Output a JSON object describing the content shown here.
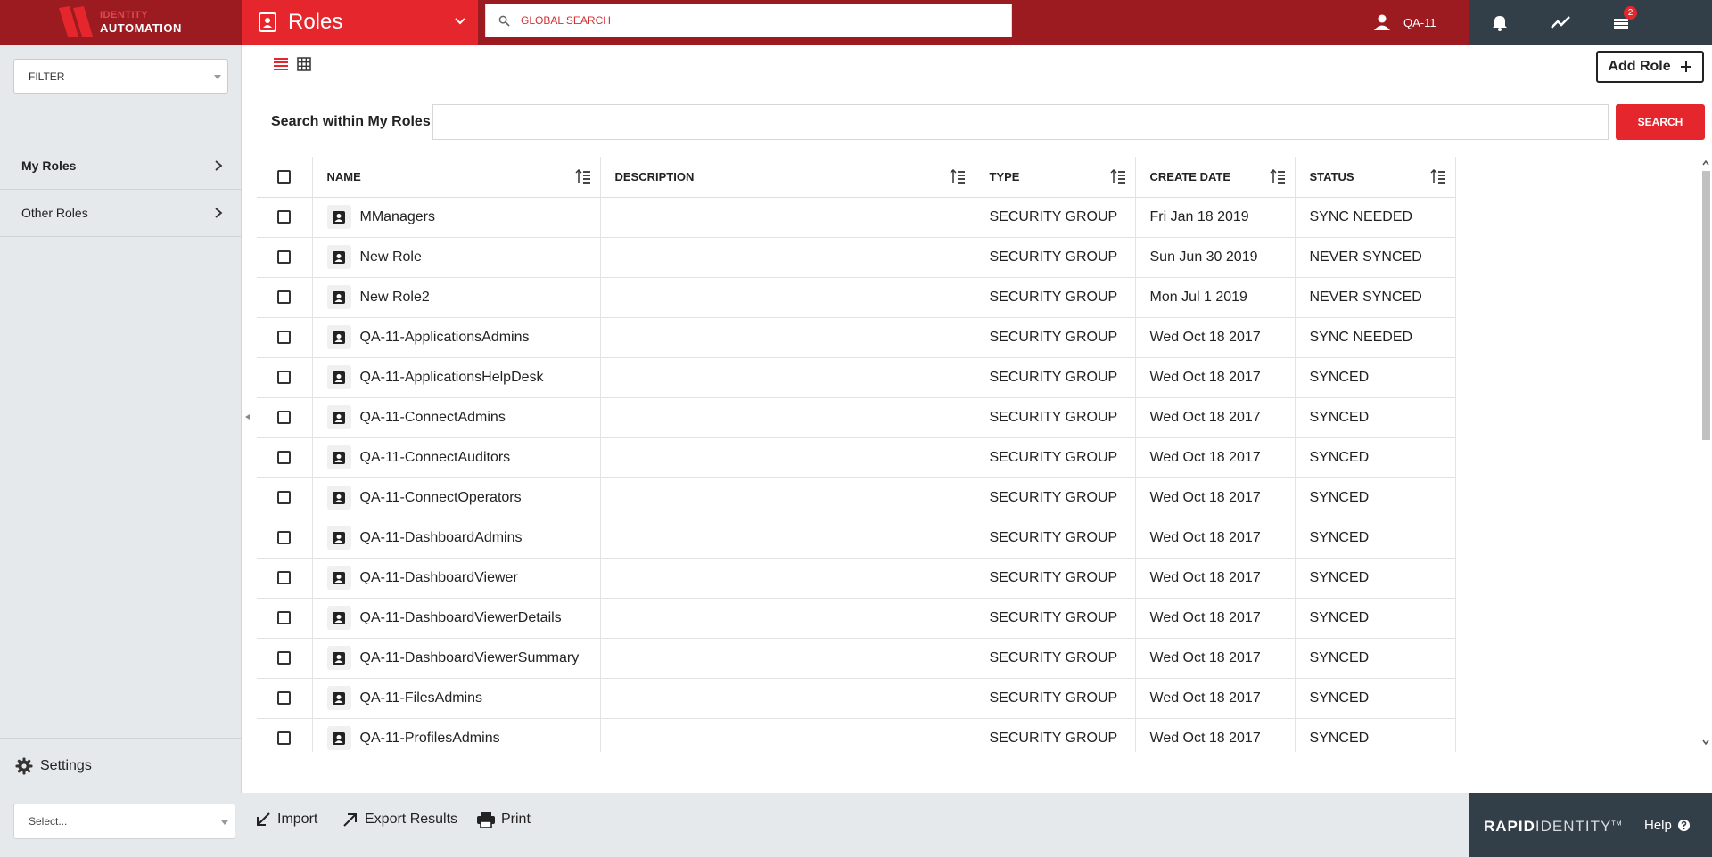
{
  "header": {
    "logo_line1": "IDENTITY",
    "logo_line2": "AUTOMATION",
    "module_title": "Roles",
    "global_search_placeholder": "GLOBAL SEARCH",
    "user_name": "QA-11",
    "notification_badge": "2"
  },
  "sidebar": {
    "filter_label": "FILTER",
    "items": [
      {
        "label": "My Roles",
        "active": true
      },
      {
        "label": "Other Roles",
        "active": false
      }
    ],
    "settings_label": "Settings"
  },
  "main": {
    "add_role_label": "Add Role",
    "search_label": "Search within My Roles:",
    "search_value": "",
    "search_button": "SEARCH"
  },
  "table": {
    "columns": [
      "NAME",
      "DESCRIPTION",
      "TYPE",
      "CREATE DATE",
      "STATUS"
    ],
    "rows": [
      {
        "name": "MManagers",
        "description": "",
        "type": "SECURITY GROUP",
        "date": "Fri Jan 18 2019",
        "status": "SYNC NEEDED"
      },
      {
        "name": "New Role",
        "description": "",
        "type": "SECURITY GROUP",
        "date": "Sun Jun 30 2019",
        "status": "NEVER SYNCED"
      },
      {
        "name": "New Role2",
        "description": "",
        "type": "SECURITY GROUP",
        "date": "Mon Jul 1 2019",
        "status": "NEVER SYNCED"
      },
      {
        "name": "QA-11-ApplicationsAdmins",
        "description": "",
        "type": "SECURITY GROUP",
        "date": "Wed Oct 18 2017",
        "status": "SYNC NEEDED"
      },
      {
        "name": "QA-11-ApplicationsHelpDesk",
        "description": "",
        "type": "SECURITY GROUP",
        "date": "Wed Oct 18 2017",
        "status": "SYNCED"
      },
      {
        "name": "QA-11-ConnectAdmins",
        "description": "",
        "type": "SECURITY GROUP",
        "date": "Wed Oct 18 2017",
        "status": "SYNCED"
      },
      {
        "name": "QA-11-ConnectAuditors",
        "description": "",
        "type": "SECURITY GROUP",
        "date": "Wed Oct 18 2017",
        "status": "SYNCED"
      },
      {
        "name": "QA-11-ConnectOperators",
        "description": "",
        "type": "SECURITY GROUP",
        "date": "Wed Oct 18 2017",
        "status": "SYNCED"
      },
      {
        "name": "QA-11-DashboardAdmins",
        "description": "",
        "type": "SECURITY GROUP",
        "date": "Wed Oct 18 2017",
        "status": "SYNCED"
      },
      {
        "name": "QA-11-DashboardViewer",
        "description": "",
        "type": "SECURITY GROUP",
        "date": "Wed Oct 18 2017",
        "status": "SYNCED"
      },
      {
        "name": "QA-11-DashboardViewerDetails",
        "description": "",
        "type": "SECURITY GROUP",
        "date": "Wed Oct 18 2017",
        "status": "SYNCED"
      },
      {
        "name": "QA-11-DashboardViewerSummary",
        "description": "",
        "type": "SECURITY GROUP",
        "date": "Wed Oct 18 2017",
        "status": "SYNCED"
      },
      {
        "name": "QA-11-FilesAdmins",
        "description": "",
        "type": "SECURITY GROUP",
        "date": "Wed Oct 18 2017",
        "status": "SYNCED"
      },
      {
        "name": "QA-11-ProfilesAdmins",
        "description": "",
        "type": "SECURITY GROUP",
        "date": "Wed Oct 18 2017",
        "status": "SYNCED"
      }
    ]
  },
  "footer": {
    "select_placeholder": "Select...",
    "import_label": "Import",
    "export_label": "Export Results",
    "print_label": "Print",
    "brand_bold": "RAPID",
    "brand_light": "IDENTITY",
    "brand_tm": "TM",
    "help_label": "Help"
  },
  "colors": {
    "header_dark_red": "#9b1b20",
    "accent_red": "#e5262c",
    "tools_slate": "#333f48",
    "sidebar_gray": "#e6e9ec"
  },
  "icons": {
    "module": "contact-card-icon",
    "search": "search-icon",
    "user": "user-icon",
    "notifications": "bell-icon",
    "activity": "trending-icon",
    "tasks": "stack-icon",
    "settings": "gear-icon",
    "import": "arrow-down-left-icon",
    "export": "arrow-up-right-icon",
    "print": "printer-icon",
    "help": "help-circle-icon"
  }
}
